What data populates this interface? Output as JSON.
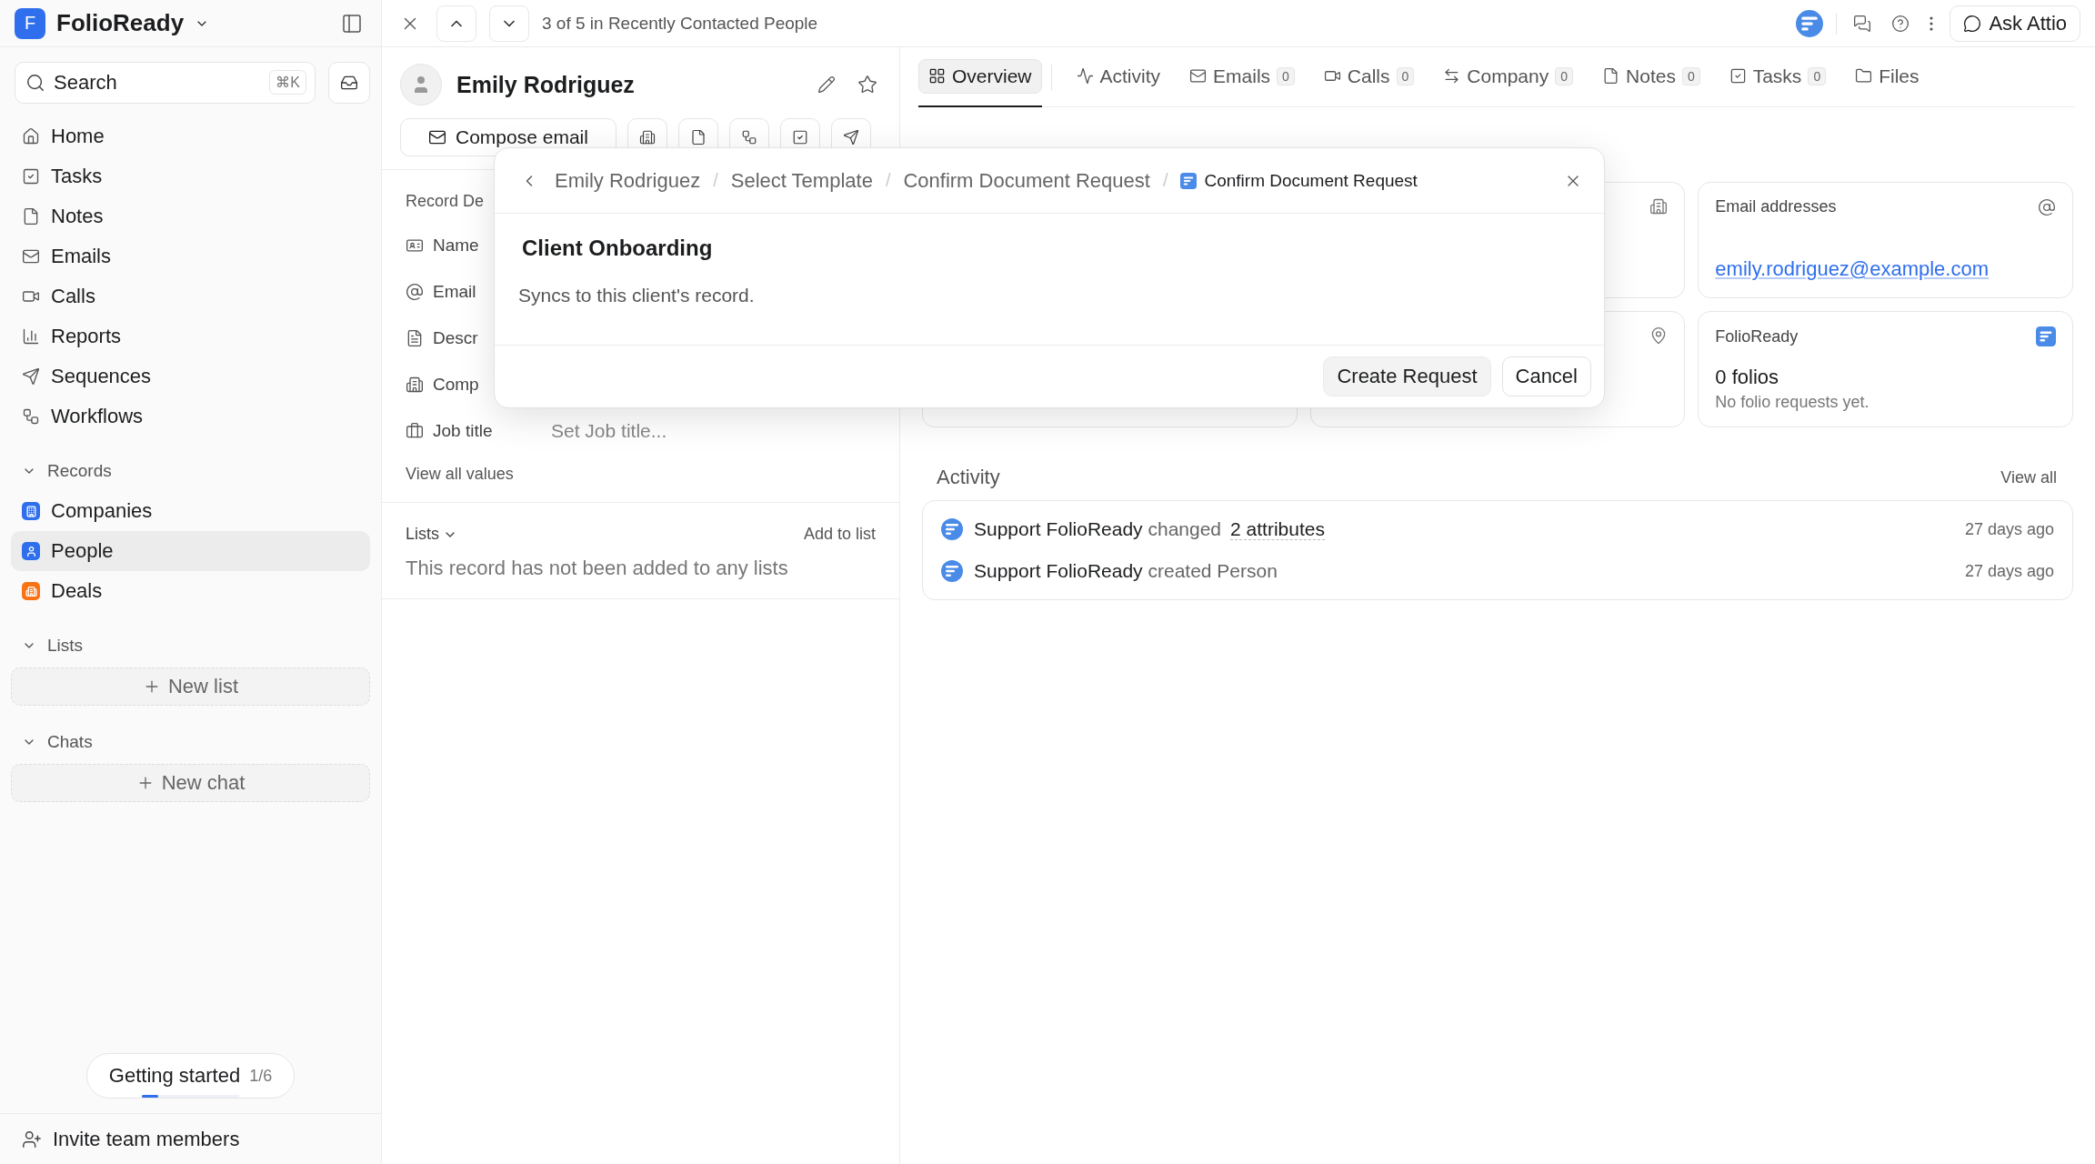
{
  "workspace": {
    "initial": "F",
    "name": "FolioReady"
  },
  "search": {
    "placeholder": "Search",
    "shortcut": "⌘K"
  },
  "nav": [
    {
      "label": "Home",
      "selected": false
    },
    {
      "label": "Tasks",
      "selected": false
    },
    {
      "label": "Notes",
      "selected": false
    },
    {
      "label": "Emails",
      "selected": false
    },
    {
      "label": "Calls",
      "selected": false
    },
    {
      "label": "Reports",
      "selected": false
    },
    {
      "label": "Sequences",
      "selected": false
    },
    {
      "label": "Workflows",
      "selected": false
    }
  ],
  "records": {
    "title": "Records",
    "expanded": true,
    "items": [
      {
        "label": "Companies",
        "color": "#2f6fed",
        "selected": false
      },
      {
        "label": "People",
        "color": "#2f6fed",
        "selected": true
      },
      {
        "label": "Deals",
        "color": "#f97316",
        "selected": false
      }
    ]
  },
  "lists": {
    "title": "Lists",
    "expanded": true,
    "new_label": "New list"
  },
  "chats": {
    "title": "Chats",
    "expanded": true,
    "new_label": "New chat"
  },
  "getting_started": {
    "label": "Getting started",
    "progress": "1/6",
    "level": 0.17
  },
  "invite": "Invite team members",
  "topbar": {
    "position": "3 of 5 in Recently Contacted People",
    "ask_button": "Ask Attio"
  },
  "person": {
    "name": "Emily Rodriguez",
    "compose_label": "Compose email"
  },
  "record_details": {
    "title": "Record De",
    "fields": [
      {
        "label": "Name"
      },
      {
        "label": "Email"
      },
      {
        "label": "Descr"
      },
      {
        "label": "Comp"
      },
      {
        "label": "Job title",
        "placeholder": "Set Job title..."
      }
    ],
    "view_all": "View all values"
  },
  "lists_panel": {
    "title": "Lists",
    "add": "Add to list",
    "empty": "This record has not been added to any lists"
  },
  "tabs": [
    {
      "label": "Overview",
      "selected": true
    },
    {
      "label": "Activity",
      "selected": false
    },
    {
      "label": "Emails",
      "count": "0",
      "selected": false
    },
    {
      "label": "Calls",
      "count": "0",
      "selected": false
    },
    {
      "label": "Company",
      "count": "0",
      "selected": false
    },
    {
      "label": "Notes",
      "count": "0",
      "selected": false
    },
    {
      "label": "Tasks",
      "count": "0",
      "selected": false
    },
    {
      "label": "Files",
      "selected": false
    }
  ],
  "cards": [
    {
      "kind": "covered"
    },
    {
      "kind": "email",
      "title": "Email addresses",
      "value": "emily.rodriguez@example.com"
    },
    {
      "kind": "covered"
    },
    {
      "kind": "covered"
    },
    {
      "kind": "folio",
      "title": "FolioReady",
      "value": "0 folios",
      "note": "No folio requests yet."
    }
  ],
  "activity": {
    "title": "Activity",
    "view_all": "View all",
    "items": [
      {
        "actor": "Support FolioReady",
        "action": "changed",
        "object": "2 attributes",
        "time": "27 days ago"
      },
      {
        "actor": "Support FolioReady",
        "action": "created Person",
        "time": "27 days ago"
      }
    ]
  },
  "modal": {
    "breadcrumbs": [
      {
        "label": "Emily Rodriguez",
        "current": false
      },
      {
        "separator": "/",
        "label": "Select Template",
        "current": false
      },
      {
        "separator": "/",
        "label": "Confirm Document Request",
        "current": false
      },
      {
        "separator": "/",
        "label": "Confirm Document Request",
        "current": true
      }
    ],
    "title": "Client Onboarding",
    "description": "Syncs to this client's record.",
    "buttons": [
      {
        "label": "Create Request",
        "kind": "primary"
      },
      {
        "label": "Cancel",
        "kind": "secondary"
      }
    ]
  }
}
